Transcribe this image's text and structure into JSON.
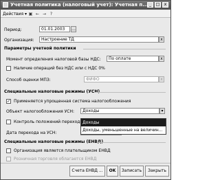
{
  "window": {
    "title": "Учетная политика (налоговый учет): Учетная п...",
    "controls": [
      "_",
      "□",
      "x"
    ]
  },
  "toolbar": {
    "actions_label": "Действия"
  },
  "fields": {
    "period_label": "Период:",
    "period_value": "01.01.2003",
    "organization_label": "Организация:",
    "organization_value": "Настроение ТД"
  },
  "sections": {
    "params": "Параметры учетной политики",
    "usn": "Специальные налоговые режимы (УСН)",
    "envd": "Специальные налоговые режимы (ЕНВД)"
  },
  "params": {
    "vat_moment_label": "Момент определения налоговой базы НДС:",
    "vat_moment_value": "По оплате",
    "vat0_label": "Наличие операций без НДС или с НДС 0%",
    "mpz_label": "Способ оценки МПЗ:",
    "mpz_value": "ФИФО"
  },
  "usn": {
    "simplified_label": "Применяется упрощенная система налогообложения",
    "object_label": "Объект налогообложения УСН:",
    "object_value": "Доходы",
    "control_label": "Контроль положений переходного",
    "transition_date_label": "Дата перехода на УСН:",
    "options": [
      "Доходы",
      "Доходы, уменьшенные на величин..."
    ]
  },
  "envd": {
    "payer_label": "Организация является плательщиком ЕНВД",
    "retail_label": "Розничная торговля облагается ЕНВД"
  },
  "footer": {
    "accounts_label": "Счета ЕНВД ...",
    "ok_label": "OK",
    "save_label": "Записать",
    "close_label": "Закрыть"
  }
}
